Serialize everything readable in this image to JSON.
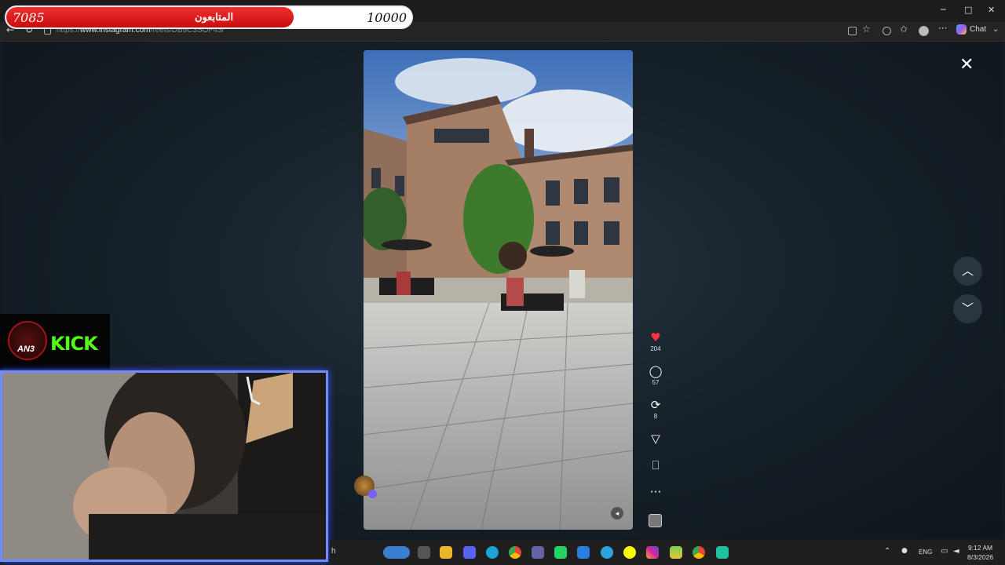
{
  "browser": {
    "url_prefix": "https://",
    "url_host": "www.instagram.com",
    "url_path": "/reels/DB9C3SOF43/",
    "chat_label": "Chat",
    "min": "─",
    "max": "□",
    "close": "✕"
  },
  "overlay": {
    "followers_current": "7085",
    "followers_label": "المتابعون",
    "followers_goal": "10000",
    "progress_fraction": 0.7085,
    "fill_color": "#e21b1b",
    "kick_text": "KICK",
    "kick_logo_text": "AN3",
    "kick_color": "#53fc18"
  },
  "reel": {
    "likes": "204",
    "comments": "57",
    "reposts": "8",
    "heart_color": "#ff3040"
  },
  "icons": {
    "back": "←",
    "reload": "↻",
    "close_x": "✕",
    "up": "︿",
    "down": "﹀",
    "heart": "♥",
    "comment": "◯",
    "repost": "⟳",
    "share": "▽",
    "bookmark": "⎕",
    "more": "···",
    "mute": "◂",
    "more_browser": "···",
    "chevron": "⌃",
    "mic": "🎙",
    "wifi": "⌔",
    "volume": "🔊"
  },
  "taskbar": {
    "search_partial": "h",
    "language": "ENG",
    "time": "9:12 AM",
    "date": "8/3/2026",
    "apps": [
      "widgets",
      "task-view",
      "file-explorer",
      "discord",
      "edge",
      "chrome",
      "teams",
      "whatsapp",
      "vpn",
      "telegram",
      "snapchat",
      "instagram",
      "bluestacks",
      "chrome-profile",
      "obs"
    ]
  }
}
